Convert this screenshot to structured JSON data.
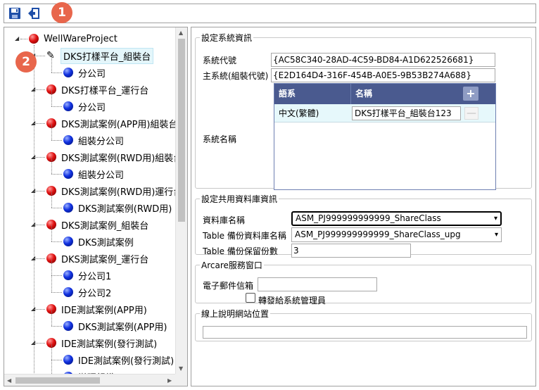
{
  "badges": [
    "1",
    "2"
  ],
  "toolbar": {
    "save_icon": "save-icon",
    "exit_icon": "exit-icon"
  },
  "tree": {
    "root": "WellWareProject",
    "items": [
      {
        "label": "DKS打樣平台_組裝台",
        "type": "edit",
        "level": 1
      },
      {
        "label": "分公司",
        "type": "blue",
        "level": 2
      },
      {
        "label": "DKS打樣平台_運行台",
        "type": "red",
        "level": 1
      },
      {
        "label": "分公司",
        "type": "blue",
        "level": 2
      },
      {
        "label": "DKS測試案例(APP用)組裝台",
        "type": "red",
        "level": 1
      },
      {
        "label": "組裝分公司",
        "type": "blue",
        "level": 2
      },
      {
        "label": "DKS測試案例(RWD用)組裝台",
        "type": "red",
        "level": 1
      },
      {
        "label": "組裝分公司",
        "type": "blue",
        "level": 2
      },
      {
        "label": "DKS測試案例(RWD用)運行台",
        "type": "red",
        "level": 1
      },
      {
        "label": "DKS測試案例(RWD用)",
        "type": "blue",
        "level": 2
      },
      {
        "label": "DKS測試案例_組裝台",
        "type": "red",
        "level": 1
      },
      {
        "label": "DKS測試案例",
        "type": "blue",
        "level": 2
      },
      {
        "label": "DKS測試案例_運行台",
        "type": "red",
        "level": 1
      },
      {
        "label": "分公司1",
        "type": "blue",
        "level": 2
      },
      {
        "label": "分公司2",
        "type": "blue",
        "level": 2
      },
      {
        "label": "IDE測試案例(APP用)",
        "type": "red",
        "level": 1
      },
      {
        "label": "DKS測試案例(APP用)",
        "type": "blue",
        "level": 2
      },
      {
        "label": "IDE測試案例(發行測試)",
        "type": "red",
        "level": 1
      },
      {
        "label": "IDE測試案例(發行測試)",
        "type": "blue",
        "level": 2
      },
      {
        "label": "辦理組織",
        "type": "blue",
        "level": 2
      }
    ]
  },
  "system_info": {
    "legend": "設定系統資訊",
    "code_label": "系統代號",
    "code_value": "{AC58C340-28AD-4C59-BD84-A1D622526681}",
    "parent_label": "主系統(組裝代號)",
    "parent_value": "{E2D164D4-316F-454B-A0E5-9B53B274A688}",
    "name_label": "系統名稱",
    "grid": {
      "col_lang": "語系",
      "col_name": "名稱",
      "row_lang": "中文(繁體)",
      "row_name": "DKS打樣平台_組裝台123"
    }
  },
  "shared_db": {
    "legend": "設定共用資料庫資訊",
    "db_label": "資料庫名稱",
    "db_value": "ASM_PJ999999999999_ShareClass",
    "backup_label": "Table 備份資料庫名稱",
    "backup_value": "ASM_PJ999999999999_ShareClass_upg",
    "keep_label": "Table 備份保留份數",
    "keep_value": "3"
  },
  "arcare": {
    "legend": "Arcare服務窗口",
    "email_label": "電子郵件信箱",
    "email_value": "",
    "forward_label": "轉發給系統管理員"
  },
  "help": {
    "legend": "線上說明網站位置",
    "url_value": ""
  }
}
